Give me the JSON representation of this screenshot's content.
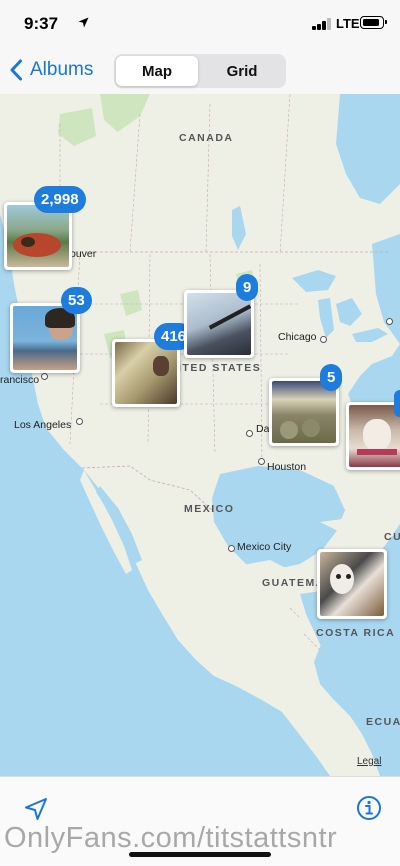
{
  "status_bar": {
    "time": "9:37",
    "network": "LTE",
    "icons": [
      "location-arrow-icon",
      "signal-icon",
      "battery-icon"
    ]
  },
  "nav": {
    "back_label": "Albums",
    "segments": [
      {
        "label": "Map",
        "selected": true
      },
      {
        "label": "Grid",
        "selected": false
      }
    ]
  },
  "map": {
    "region_labels": {
      "canada": "CANADA",
      "united_states": "ITED STATES",
      "mexico": "MEXICO",
      "guatemala": "GUATEMA",
      "costa_rica": "COSTA RICA",
      "ecuador": "ECUA",
      "cuba": "CU"
    },
    "cities": {
      "vancouver": "ouver",
      "san_francisco": "rancisco",
      "los_angeles": "Los Angeles",
      "chicago": "Chicago",
      "dallas": "Dal",
      "houston": "Houston",
      "mexico_city": "Mexico City"
    },
    "legal": "Legal",
    "clusters": [
      {
        "count": "2,998",
        "place": "Pacific Northwest"
      },
      {
        "count": "53",
        "place": "California coast"
      },
      {
        "count": "416",
        "place": "Southwest"
      },
      {
        "count": "9",
        "place": "Midwest"
      },
      {
        "count": "5",
        "place": "Texas"
      },
      {
        "count": "",
        "place": "Southeast"
      },
      {
        "count": "",
        "place": "Central America"
      }
    ]
  },
  "toolbar": {
    "left_icon": "navigation-arrow-icon",
    "right_icon": "info-icon"
  },
  "watermark": "OnlyFans.com/titstattsntr",
  "colors": {
    "accent": "#1976d6",
    "badge": "#1d7cdc",
    "water": "#a9d7f0",
    "land": "#eef0e6",
    "park": "#cfe5c0"
  }
}
